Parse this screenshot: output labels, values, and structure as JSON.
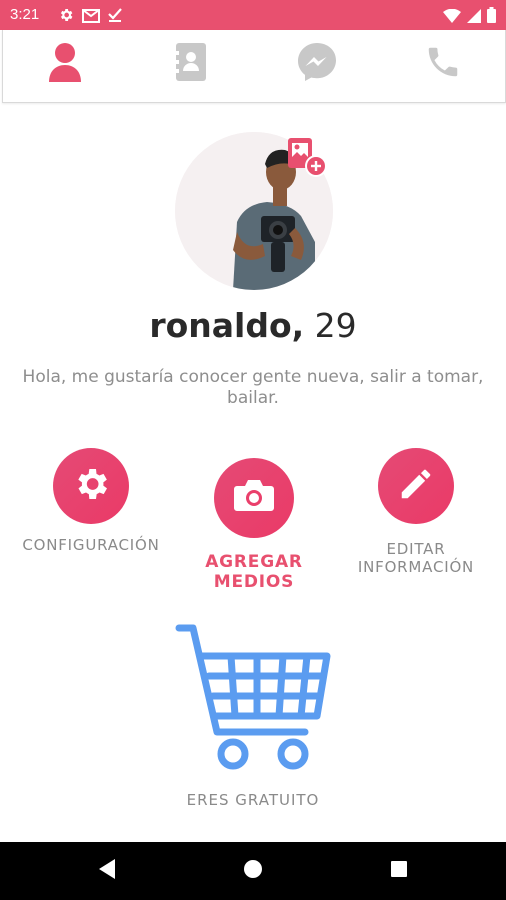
{
  "status_bar": {
    "time": "3:21",
    "left_icons": [
      "settings-icon",
      "gmail-icon",
      "download-done-icon"
    ],
    "right_icons": [
      "wifi-icon",
      "signal-icon",
      "battery-icon"
    ],
    "color": "#e8506f"
  },
  "top_nav": {
    "tabs": [
      {
        "name": "profile",
        "icon": "person-icon",
        "active": true
      },
      {
        "name": "contacts",
        "icon": "contact-card-icon",
        "active": false
      },
      {
        "name": "messenger",
        "icon": "messenger-icon",
        "active": false
      },
      {
        "name": "calls",
        "icon": "phone-icon",
        "active": false
      }
    ],
    "active_color": "#e8506f",
    "inactive_color": "#c8c8c8"
  },
  "profile": {
    "name": "ronaldo,",
    "age": "29",
    "bio": "Hola, me gustaría conocer gente nueva, salir a tomar, bailar."
  },
  "actions": {
    "settings_label": "CONFIGURACIÓN",
    "add_media_label_1": "AGREGAR",
    "add_media_label_2": "MEDIOS",
    "edit_label_1": "EDITAR",
    "edit_label_2": "INFORMACIÓN"
  },
  "subscription": {
    "label": "ERES GRATUITO",
    "icon": "shopping-cart-icon",
    "color": "#5b9cf0"
  },
  "android_nav": {
    "buttons": [
      "back-icon",
      "home-icon",
      "recents-icon"
    ]
  }
}
